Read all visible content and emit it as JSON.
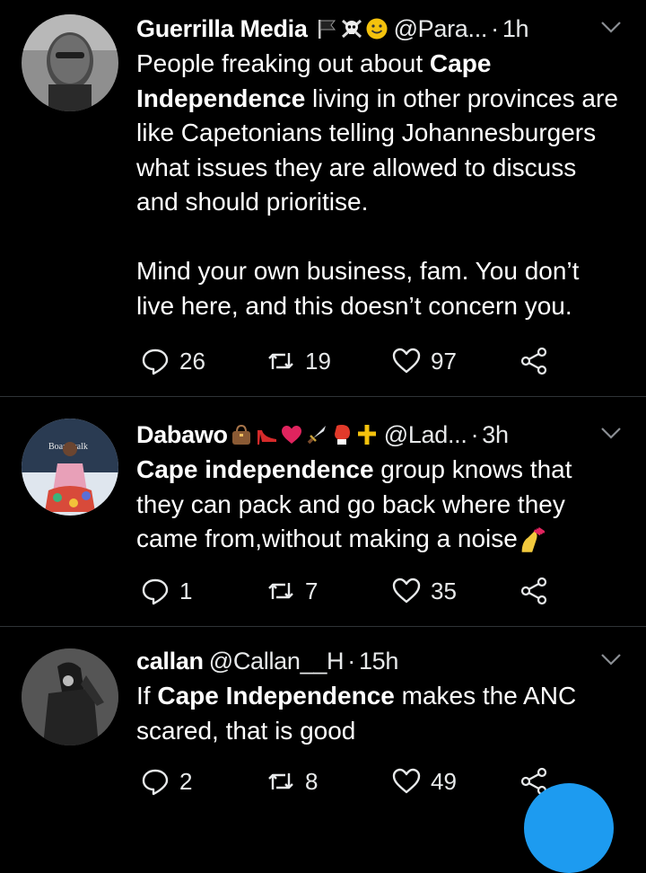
{
  "tweets": [
    {
      "name": "Guerrilla Media",
      "handle": "@Para...",
      "dot": "·",
      "time": "1h",
      "body": [
        {
          "text": "People freaking out about ",
          "bold": false
        },
        {
          "text": "Cape Independence",
          "bold": true
        },
        {
          "text": " living in other provinces are like Capetonians telling Johannesburgers what issues they are allowed to discuss and should prioritise.",
          "bold": false
        }
      ],
      "body2": "Mind your own business, fam. You don’t live here, and this doesn’t concern you.",
      "replies": "26",
      "retweets": "19",
      "likes": "97",
      "name_emojis": [
        "flag-icon",
        "skull-crossbones-icon",
        "smiley-icon"
      ]
    },
    {
      "name": "Dabawo",
      "handle": "@Lad...",
      "dot": "·",
      "time": "3h",
      "body": [
        {
          "text": "Cape independence",
          "bold": true
        },
        {
          "text": " group knows that they can pack and go back where they came from,without making a noise",
          "bold": false
        }
      ],
      "replies": "1",
      "retweets": "7",
      "likes": "35",
      "avatar_text": "Boardwalk",
      "name_emojis": [
        "handbag-icon",
        "high-heel-icon",
        "heart-icon",
        "dagger-icon",
        "boxing-glove-icon",
        "cross-icon"
      ],
      "trailing_emoji": "nail-polish-icon"
    },
    {
      "name": "callan",
      "handle": "@Callan__H",
      "dot": "·",
      "time": "15h",
      "body": [
        {
          "text": "If ",
          "bold": false
        },
        {
          "text": "Cape Independence",
          "bold": true
        },
        {
          "text": " makes the ANC scared, that is good",
          "bold": false
        }
      ],
      "replies": "2",
      "retweets": "8",
      "likes": "49"
    }
  ],
  "colors": {
    "background": "#000000",
    "text": "#ffffff",
    "divider": "#2f3336",
    "accent": "#1d9bf0",
    "heart": "#e0245e",
    "gold": "#f4c20d"
  }
}
